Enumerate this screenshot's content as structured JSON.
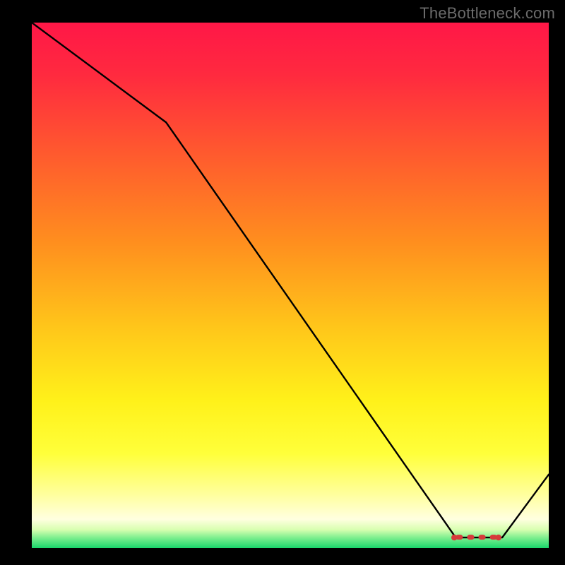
{
  "watermark": "TheBottleneck.com",
  "chart_data": {
    "type": "line",
    "title": "",
    "xlabel": "",
    "ylabel": "",
    "xlim": [
      0,
      100
    ],
    "ylim": [
      0,
      100
    ],
    "x": [
      0,
      26,
      82,
      91,
      100
    ],
    "values": [
      100,
      81,
      2,
      2,
      14
    ],
    "marker_region": {
      "x_start": 82,
      "x_end": 90,
      "y": 2
    },
    "background_gradient": {
      "stops": [
        {
          "offset": 0.0,
          "color": "#ff1747"
        },
        {
          "offset": 0.1,
          "color": "#ff2a3f"
        },
        {
          "offset": 0.25,
          "color": "#ff5a2e"
        },
        {
          "offset": 0.42,
          "color": "#ff8f1e"
        },
        {
          "offset": 0.58,
          "color": "#ffc61a"
        },
        {
          "offset": 0.72,
          "color": "#fff11a"
        },
        {
          "offset": 0.82,
          "color": "#ffff3a"
        },
        {
          "offset": 0.9,
          "color": "#ffffa0"
        },
        {
          "offset": 0.945,
          "color": "#ffffe0"
        },
        {
          "offset": 0.965,
          "color": "#d8ffb0"
        },
        {
          "offset": 0.98,
          "color": "#7fef8f"
        },
        {
          "offset": 1.0,
          "color": "#19d66b"
        }
      ]
    }
  }
}
